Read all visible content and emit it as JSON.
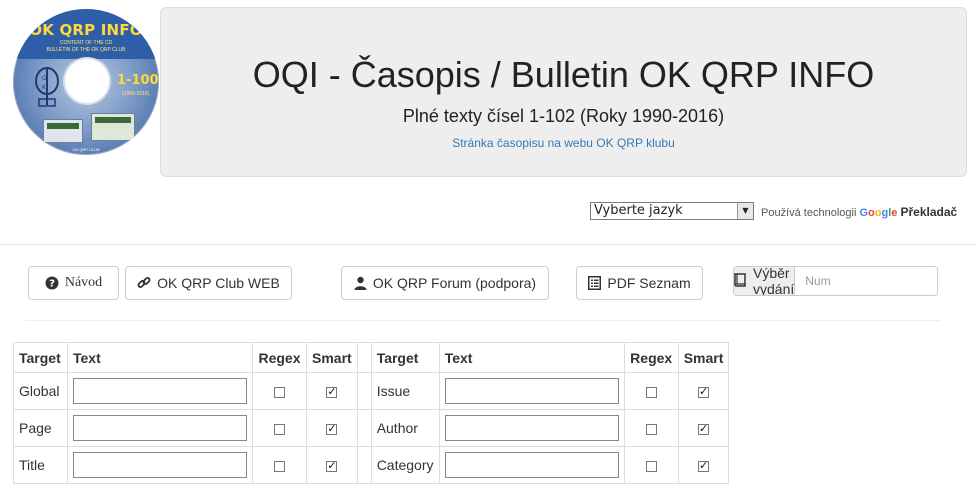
{
  "logo": {
    "title": "OK QRP INFO",
    "subtitle_line1": "CONTENT OF THE CD",
    "subtitle_line2": "BULLETIN OF THE OK QRP CLUB",
    "range": "1-100",
    "years": "(1990-2016)",
    "bottom": "OK QRP CLUB"
  },
  "header": {
    "title": "OQI - Časopis / Bulletin OK QRP INFO",
    "subtitle": "Plné texty čísel 1-102 (Roky 1990-2016)",
    "link": "Stránka časopisu na webu OK QRP klubu"
  },
  "translate": {
    "select_value": "Vyberte jazyk",
    "powered_by": "Používá technologii",
    "google_letters": [
      "G",
      "o",
      "o",
      "g",
      "l",
      "e"
    ],
    "translator": "Překladač"
  },
  "toolbar": {
    "help_label": "Návod",
    "club_label": "OK QRP Club WEB",
    "forum_label": "OK QRP Forum (podpora)",
    "pdf_label": "PDF Seznam",
    "issue_label": "Výběr vydání",
    "issue_placeholder": "Num"
  },
  "search_table": {
    "headers": [
      "Target",
      "Text",
      "Regex",
      "Smart",
      "Target",
      "Text",
      "Regex",
      "Smart"
    ],
    "rows": [
      {
        "left": {
          "target": "Global",
          "regex": false,
          "smart": true
        },
        "right": {
          "target": "Issue",
          "regex": false,
          "smart": true
        }
      },
      {
        "left": {
          "target": "Page",
          "regex": false,
          "smart": true
        },
        "right": {
          "target": "Author",
          "regex": false,
          "smart": true
        }
      },
      {
        "left": {
          "target": "Title",
          "regex": false,
          "smart": true
        },
        "right": {
          "target": "Category",
          "regex": false,
          "smart": true
        }
      }
    ]
  },
  "colors": {
    "link": "#337ab7",
    "jumbotron_bg": "#eeeeee",
    "border": "#cccccc"
  }
}
